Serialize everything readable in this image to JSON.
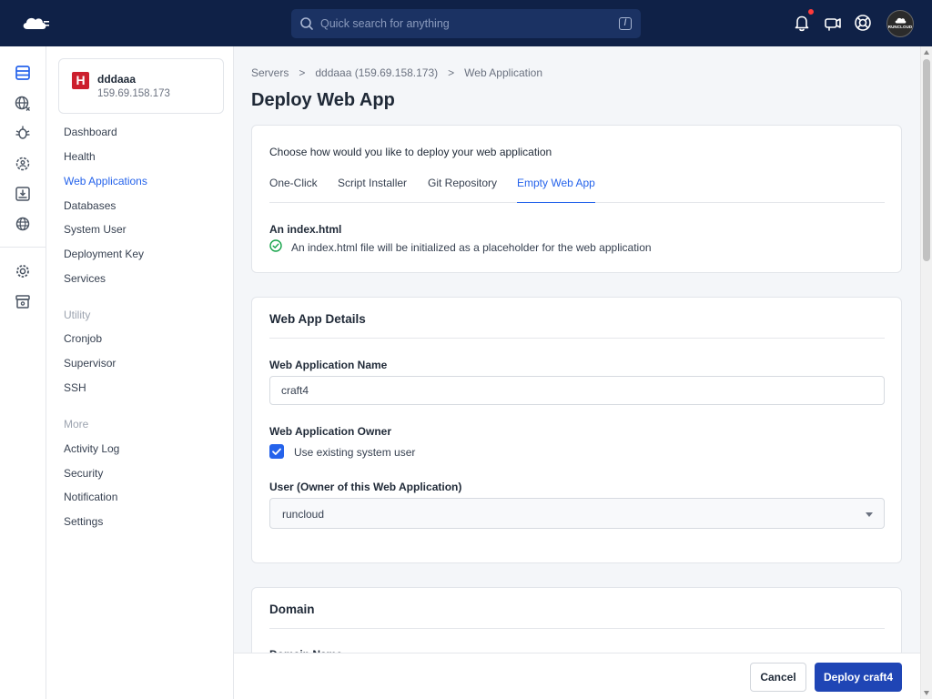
{
  "topbar": {
    "search_placeholder": "Quick search for anything",
    "search_shortcut": "/",
    "avatar_text": "RUNCLOUD"
  },
  "server": {
    "badge": "H",
    "name": "dddaaa",
    "ip": "159.69.158.173"
  },
  "sidebar": {
    "items": [
      {
        "label": "Dashboard"
      },
      {
        "label": "Health"
      },
      {
        "label": "Web Applications"
      },
      {
        "label": "Databases"
      },
      {
        "label": "System User"
      },
      {
        "label": "Deployment Key"
      },
      {
        "label": "Services"
      }
    ],
    "utility_title": "Utility",
    "utility_items": [
      {
        "label": "Cronjob"
      },
      {
        "label": "Supervisor"
      },
      {
        "label": "SSH"
      }
    ],
    "more_title": "More",
    "more_items": [
      {
        "label": "Activity Log"
      },
      {
        "label": "Security"
      },
      {
        "label": "Notification"
      },
      {
        "label": "Settings"
      }
    ]
  },
  "breadcrumb": {
    "items": [
      "Servers",
      "dddaaa (159.69.158.173)",
      "Web Application"
    ],
    "separator": ">"
  },
  "page": {
    "title": "Deploy Web App"
  },
  "deploy": {
    "lead": "Choose how would you like to deploy your web application",
    "tabs": [
      {
        "label": "One-Click"
      },
      {
        "label": "Script Installer"
      },
      {
        "label": "Git Repository"
      },
      {
        "label": "Empty Web App"
      }
    ],
    "active_tab": "Empty Web App",
    "index_title": "An index.html",
    "index_text": "An index.html file will be initialized as a placeholder for the web application"
  },
  "details": {
    "heading": "Web App Details",
    "name_label": "Web Application Name",
    "name_value": "craft4",
    "owner_label": "Web Application Owner",
    "checkbox_label": "Use existing system user",
    "checkbox_checked": true,
    "user_label": "User (Owner of this Web Application)",
    "user_value": "runcloud"
  },
  "domain": {
    "heading": "Domain",
    "partial_label": "Domain Name"
  },
  "footer": {
    "cancel_label": "Cancel",
    "deploy_label": "Deploy craft4"
  },
  "colors": {
    "topbar_bg": "#0f2147",
    "accent": "#2563eb",
    "deploy_button": "#1f45b5",
    "server_badge": "#cc1f2d",
    "notification_dot": "#ff3b3b",
    "success": "#16a34a"
  }
}
